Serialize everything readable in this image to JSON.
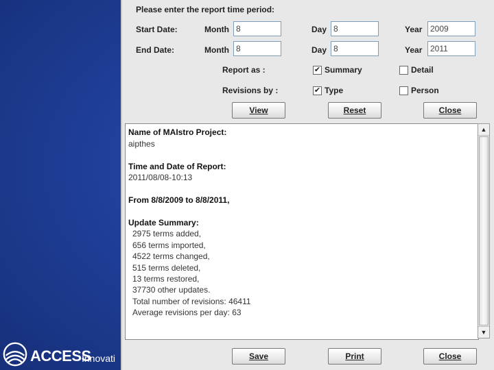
{
  "logo": {
    "brand": "ACCESS",
    "sub": "Innovati"
  },
  "form": {
    "prompt": "Please enter the report time period:",
    "start_label": "Start Date:",
    "end_label": "End  Date:",
    "month_label": "Month",
    "day_label": "Day",
    "year_label": "Year",
    "start": {
      "month": "8",
      "day": "8",
      "year": "2009"
    },
    "end": {
      "month": "8",
      "day": "8",
      "year": "2011"
    },
    "report_as_label": "Report as :",
    "revisions_by_label": "Revisions by :",
    "summary_label": "Summary",
    "summary_checked": true,
    "detail_label": "Detail",
    "detail_checked": false,
    "type_label": "Type",
    "type_checked": true,
    "person_label": "Person",
    "person_checked": false,
    "view_button": "View",
    "reset_button": "Reset",
    "close_button": "Close"
  },
  "report": {
    "project_heading": "Name of MAIstro Project:",
    "project_name": "aipthes",
    "time_heading": "Time and Date of Report:",
    "time_value": "2011/08/08-10:13",
    "range_heading": "From 8/8/2009 to 8/8/2011,",
    "summary_heading": "Update Summary:",
    "lines": [
      "2975 terms added,",
      "656 terms imported,",
      "4522 terms changed,",
      "515 terms deleted,",
      "13 terms restored,",
      "37730 other updates.",
      "Total number of revisions: 46411",
      "Average revisions per day: 63"
    ]
  },
  "footer": {
    "save_button": "Save",
    "print_button": "Print",
    "close_button": "Close"
  }
}
